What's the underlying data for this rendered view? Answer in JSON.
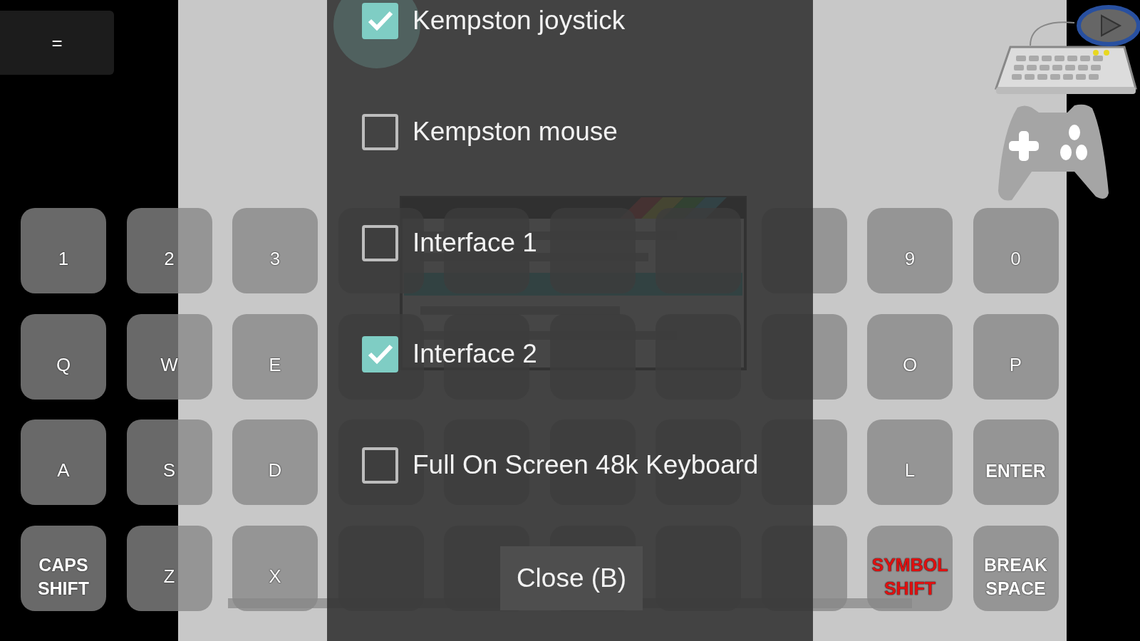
{
  "menu_button": {
    "label": "="
  },
  "keyboard": {
    "rows": [
      [
        {
          "kind": "char",
          "label": "1",
          "color": "#ffffff"
        },
        {
          "kind": "char",
          "label": "2",
          "color": "#ffffff"
        },
        {
          "kind": "char",
          "label": "3",
          "color": "#ffffff"
        },
        {
          "kind": "blank"
        },
        {
          "kind": "blank"
        },
        {
          "kind": "blank"
        },
        {
          "kind": "blank"
        },
        {
          "kind": "blank"
        },
        {
          "kind": "char",
          "label": "9",
          "color": "#ffffff"
        },
        {
          "kind": "char",
          "label": "0",
          "color": "#ffffff"
        }
      ],
      [
        {
          "kind": "char",
          "label": "Q",
          "color": "#ffffff"
        },
        {
          "kind": "char",
          "label": "W",
          "color": "#ffffff"
        },
        {
          "kind": "char",
          "label": "E",
          "color": "#ffffff"
        },
        {
          "kind": "blank"
        },
        {
          "kind": "blank"
        },
        {
          "kind": "blank"
        },
        {
          "kind": "blank"
        },
        {
          "kind": "blank"
        },
        {
          "kind": "char",
          "label": "O",
          "color": "#ffffff"
        },
        {
          "kind": "char",
          "label": "P",
          "color": "#ffffff"
        }
      ],
      [
        {
          "kind": "char",
          "label": "A",
          "color": "#ffffff"
        },
        {
          "kind": "char",
          "label": "S",
          "color": "#ffffff"
        },
        {
          "kind": "char",
          "label": "D",
          "color": "#ffffff"
        },
        {
          "kind": "blank"
        },
        {
          "kind": "blank"
        },
        {
          "kind": "blank"
        },
        {
          "kind": "blank"
        },
        {
          "kind": "blank"
        },
        {
          "kind": "char",
          "label": "L",
          "color": "#ffffff"
        },
        {
          "kind": "char",
          "label": "ENTER",
          "color": "#ffffff"
        }
      ],
      [
        {
          "kind": "char",
          "label": "CAPS SHIFT",
          "color": "#ffffff"
        },
        {
          "kind": "char",
          "label": "Z",
          "color": "#ffffff"
        },
        {
          "kind": "char",
          "label": "X",
          "color": "#ffffff"
        },
        {
          "kind": "blank"
        },
        {
          "kind": "blank"
        },
        {
          "kind": "blank"
        },
        {
          "kind": "blank"
        },
        {
          "kind": "blank"
        },
        {
          "kind": "char",
          "label": "SYMBOL SHIFT",
          "color": "#e01010"
        },
        {
          "kind": "char",
          "label": "BREAK SPACE",
          "color": "#ffffff"
        }
      ]
    ]
  },
  "dialog": {
    "options": [
      {
        "label": "Kempston joystick",
        "checked": true,
        "focused": true
      },
      {
        "label": "Kempston mouse",
        "checked": false,
        "focused": false
      },
      {
        "label": "Interface 1",
        "checked": false,
        "focused": false
      },
      {
        "label": "Interface 2",
        "checked": true,
        "focused": false
      },
      {
        "label": "Full On Screen 48k Keyboard",
        "checked": false,
        "focused": false
      }
    ],
    "close_button": {
      "label": "Close (B)"
    }
  }
}
